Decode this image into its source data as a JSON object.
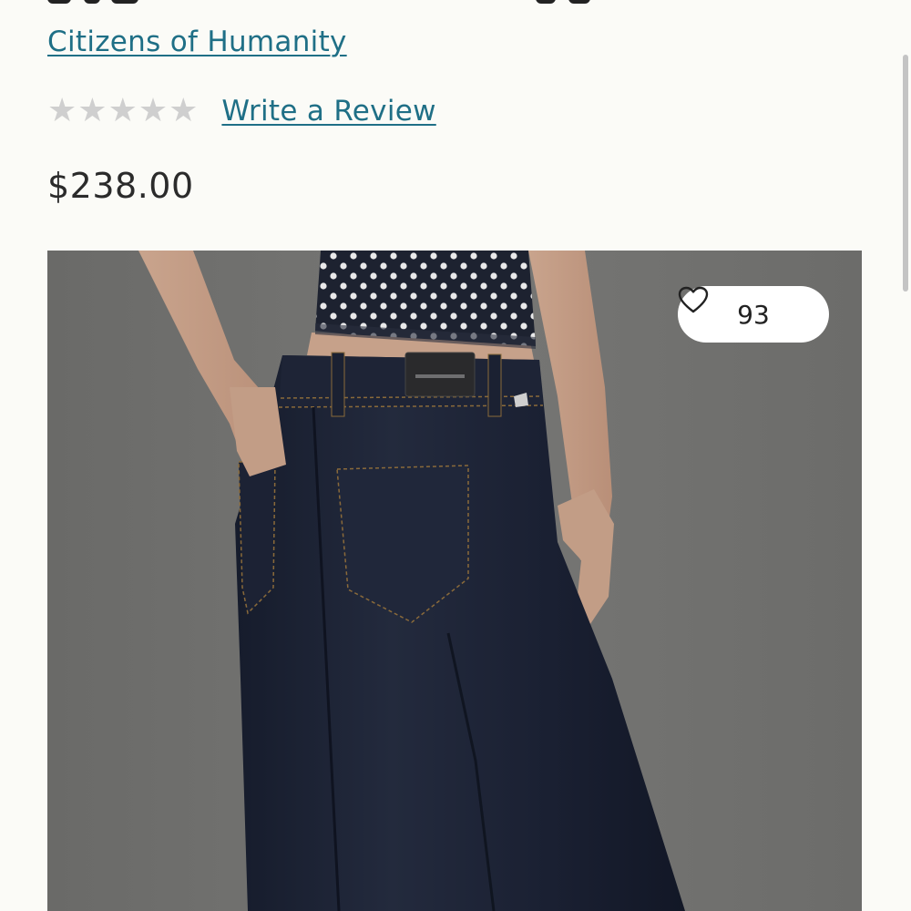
{
  "product": {
    "brand": "Citizens of Humanity",
    "rating": {
      "stars_filled": 0,
      "stars_total": 5,
      "write_review_label": "Write a Review"
    },
    "price": "$238.00",
    "image": {
      "likes_count": "93",
      "heart_icon": "heart-outline-icon"
    }
  },
  "colors": {
    "link": "#1f6f86",
    "star_empty": "#cfcfcf",
    "background": "#fbfbf7"
  }
}
